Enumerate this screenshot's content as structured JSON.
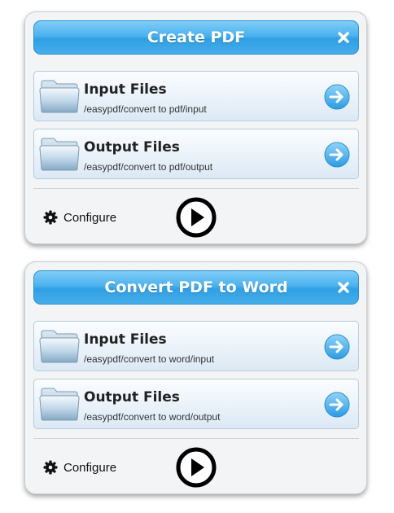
{
  "panels": [
    {
      "title": "Create PDF",
      "rows": [
        {
          "label": "Input Files",
          "path": "/easypdf/convert to pdf/input"
        },
        {
          "label": "Output Files",
          "path": "/easypdf/convert to pdf/output"
        }
      ],
      "configure_label": "Configure"
    },
    {
      "title": "Convert PDF to Word",
      "rows": [
        {
          "label": "Input Files",
          "path": "/easypdf/convert to word/input"
        },
        {
          "label": "Output Files",
          "path": "/easypdf/convert to word/output"
        }
      ],
      "configure_label": "Configure"
    }
  ],
  "icons": {
    "close": "close-icon",
    "folder": "folder-icon",
    "arrow": "arrow-right-circle-icon",
    "gear": "gear-icon",
    "play": "play-icon"
  },
  "colors": {
    "titlebar": "#3aa8ea",
    "arrow": "#4db3ec",
    "row_border": "#b7cbdc"
  }
}
